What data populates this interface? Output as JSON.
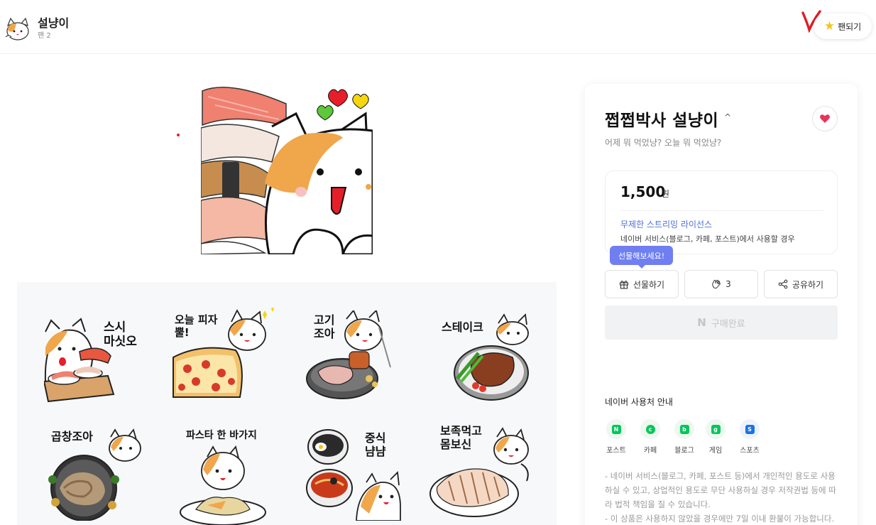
{
  "header": {
    "creator_name": "설냥이",
    "fan_count": "팬 2",
    "fan_button_label": "팬되기"
  },
  "gallery": {
    "stickers": [
      {
        "caption": "스시\n마싯오"
      },
      {
        "caption": "오늘 피자\n뿔!"
      },
      {
        "caption": "고기\n조아"
      },
      {
        "caption": "스테이크"
      },
      {
        "caption": "곱창조아"
      },
      {
        "caption": "파스타 한 바가지"
      },
      {
        "caption": "중식\n냠냠"
      },
      {
        "caption": "보족먹고\n몸보신"
      }
    ]
  },
  "product": {
    "title": "쩝쩝박사 설냥이",
    "subtitle": "어제 뭐 먹었냥? 오늘 뭐 먹었냥?",
    "price": "1,500",
    "price_unit": "원",
    "license_title": "무제한 스트리밍 라이선스",
    "license_desc": "네이버 서비스(블로그, 카페, 포스트)에서 사용할 경우",
    "tooltip": "선물해보세요!",
    "gift_label": "선물하기",
    "clap_count": "3",
    "share_label": "공유하기",
    "buy_label": "구매완료"
  },
  "usage": {
    "title": "네이버 사용처 안내",
    "services": [
      {
        "name": "포스트",
        "icon": "post-icon",
        "color": "#03c75a",
        "glyph": "N"
      },
      {
        "name": "카페",
        "icon": "cafe-icon",
        "color": "#03c75a",
        "glyph": "☕"
      },
      {
        "name": "블로그",
        "icon": "blog-icon",
        "color": "#03c75a",
        "glyph": "b"
      },
      {
        "name": "게임",
        "icon": "game-icon",
        "color": "#03c75a",
        "glyph": "●"
      },
      {
        "name": "스포츠",
        "icon": "sports-icon",
        "color": "#1a73e8",
        "glyph": "S"
      }
    ]
  },
  "notice": {
    "line1": "- 네이버 서비스(블로그, 카페, 포스트 등)에서 개인적인 용도로 사용하실 수 있고, 상업적인 용도로 무단 사용하실 경우 저작권법 등에 따라 법적 책임을 질 수 있습니다.",
    "line2": "- 이 상품은 사용하지 않았을 경우에만 7일 이내 환불이 가능합니다."
  },
  "colors": {
    "accent": "#6f7ff2",
    "license_link": "#4c6fd8",
    "heart": "#e8345a",
    "cat_orange": "#f0a64b"
  }
}
